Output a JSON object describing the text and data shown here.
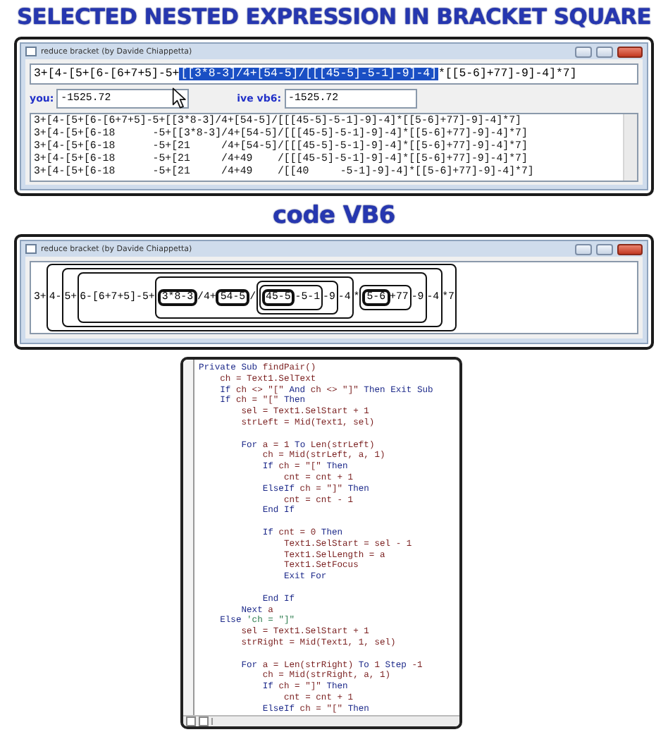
{
  "heading": "SELECTED NESTED EXPRESSION IN BRACKET SQUARE",
  "window": {
    "title": "reduce bracket (by Davide Chiappetta)",
    "expression": {
      "before": "3+[4-[5+[6-[6+7+5]-5+",
      "selected": "[[3*8-3]/4+[54-5]/[[[45-5]-5-1]-9]-4]",
      "after": "*[[5-6]+77]-9]-4]*7]"
    },
    "you_label": "you:",
    "you_value": "-1525.72",
    "native_label": "ive vb6:",
    "native_value": "-1525.72",
    "steps": [
      "3+[4-[5+[6-[6+7+5]-5+[[3*8-3]/4+[54-5]/[[[45-5]-5-1]-9]-4]*[[5-6]+77]-9]-4]*7]",
      "3+[4-[5+[6-18      -5+[[3*8-3]/4+[54-5]/[[[45-5]-5-1]-9]-4]*[[5-6]+77]-9]-4]*7]",
      "3+[4-[5+[6-18      -5+[21     /4+[54-5]/[[[45-5]-5-1]-9]-4]*[[5-6]+77]-9]-4]*7]",
      "3+[4-[5+[6-18      -5+[21     /4+49    /[[[45-5]-5-1]-9]-4]*[[5-6]+77]-9]-4]*7]",
      "3+[4-[5+[6-18      -5+[21     /4+49    /[[40     -5-1]-9]-4]*[[5-6]+77]-9]-4]*7]"
    ]
  },
  "section_title": "code VB6",
  "bracket_window": {
    "title": "reduce bracket (by Davide Chiappetta)",
    "expression": [
      {
        "text": "3+"
      },
      {
        "children": [
          {
            "text": "4-"
          },
          {
            "children": [
              {
                "text": "5+"
              },
              {
                "children": [
                  {
                    "text": "6-[6+7+5]-5+"
                  },
                  {
                    "children": [
                      {
                        "children": [
                          {
                            "text": "3*8-3"
                          }
                        ]
                      },
                      {
                        "text": "/4+"
                      },
                      {
                        "children": [
                          {
                            "text": "54-5"
                          }
                        ]
                      },
                      {
                        "text": "/"
                      },
                      {
                        "children": [
                          {
                            "children": [
                              {
                                "children": [
                                  {
                                    "text": "45-5"
                                  }
                                ]
                              },
                              {
                                "text": "-5-1"
                              }
                            ]
                          },
                          {
                            "text": "-9"
                          }
                        ]
                      },
                      {
                        "text": "-4"
                      }
                    ]
                  },
                  {
                    "text": "*"
                  },
                  {
                    "children": [
                      {
                        "children": [
                          {
                            "text": "5-6"
                          }
                        ]
                      },
                      {
                        "text": "+77"
                      }
                    ]
                  },
                  {
                    "text": "-9"
                  }
                ]
              },
              {
                "text": "-4"
              }
            ]
          },
          {
            "text": "*7"
          }
        ]
      }
    ]
  },
  "code": [
    {
      "kind": "code",
      "spans": [
        {
          "kind": "keyword",
          "text": "Private Sub "
        },
        {
          "kind": "text",
          "text": "findPair()"
        }
      ]
    },
    {
      "kind": "code",
      "spans": [
        {
          "kind": "text",
          "text": "    ch = Text1.SelText"
        }
      ]
    },
    {
      "kind": "code",
      "spans": [
        {
          "kind": "keyword",
          "text": "    If "
        },
        {
          "kind": "text",
          "text": "ch <> \"[\" "
        },
        {
          "kind": "keyword",
          "text": "And "
        },
        {
          "kind": "text",
          "text": "ch <> \"]\" "
        },
        {
          "kind": "keyword",
          "text": "Then Exit Sub"
        }
      ]
    },
    {
      "kind": "code",
      "spans": [
        {
          "kind": "keyword",
          "text": "    If "
        },
        {
          "kind": "text",
          "text": "ch = \"[\" "
        },
        {
          "kind": "keyword",
          "text": "Then"
        }
      ]
    },
    {
      "kind": "code",
      "spans": [
        {
          "kind": "text",
          "text": "        sel = Text1.SelStart + 1"
        }
      ]
    },
    {
      "kind": "code",
      "spans": [
        {
          "kind": "text",
          "text": "        strLeft = Mid(Text1, sel)"
        }
      ]
    },
    {
      "kind": "blank"
    },
    {
      "kind": "code",
      "spans": [
        {
          "kind": "keyword",
          "text": "        For "
        },
        {
          "kind": "text",
          "text": "a = 1 "
        },
        {
          "kind": "keyword",
          "text": "To "
        },
        {
          "kind": "text",
          "text": "Len(strLeft)"
        }
      ]
    },
    {
      "kind": "code",
      "spans": [
        {
          "kind": "text",
          "text": "            ch = Mid(strLeft, a, 1)"
        }
      ]
    },
    {
      "kind": "code",
      "spans": [
        {
          "kind": "keyword",
          "text": "            If "
        },
        {
          "kind": "text",
          "text": "ch = \"[\" "
        },
        {
          "kind": "keyword",
          "text": "Then"
        }
      ]
    },
    {
      "kind": "code",
      "spans": [
        {
          "kind": "text",
          "text": "                cnt = cnt + 1"
        }
      ]
    },
    {
      "kind": "code",
      "spans": [
        {
          "kind": "keyword",
          "text": "            ElseIf "
        },
        {
          "kind": "text",
          "text": "ch = \"]\" "
        },
        {
          "kind": "keyword",
          "text": "Then"
        }
      ]
    },
    {
      "kind": "code",
      "spans": [
        {
          "kind": "text",
          "text": "                cnt = cnt - 1"
        }
      ]
    },
    {
      "kind": "code",
      "spans": [
        {
          "kind": "keyword",
          "text": "            End If"
        }
      ]
    },
    {
      "kind": "blank"
    },
    {
      "kind": "code",
      "spans": [
        {
          "kind": "keyword",
          "text": "            If "
        },
        {
          "kind": "text",
          "text": "cnt = 0 "
        },
        {
          "kind": "keyword",
          "text": "Then"
        }
      ]
    },
    {
      "kind": "code",
      "spans": [
        {
          "kind": "text",
          "text": "                Text1.SelStart = sel - 1"
        }
      ]
    },
    {
      "kind": "code",
      "spans": [
        {
          "kind": "text",
          "text": "                Text1.SelLength = a"
        }
      ]
    },
    {
      "kind": "code",
      "spans": [
        {
          "kind": "text",
          "text": "                Text1.SetFocus"
        }
      ]
    },
    {
      "kind": "code",
      "spans": [
        {
          "kind": "keyword",
          "text": "                Exit For"
        }
      ]
    },
    {
      "kind": "blank"
    },
    {
      "kind": "code",
      "spans": [
        {
          "kind": "keyword",
          "text": "            End If"
        }
      ]
    },
    {
      "kind": "code",
      "spans": [
        {
          "kind": "keyword",
          "text": "        Next "
        },
        {
          "kind": "text",
          "text": "a"
        }
      ]
    },
    {
      "kind": "code",
      "spans": [
        {
          "kind": "keyword",
          "text": "    Else "
        },
        {
          "kind": "comment",
          "text": "'ch = \"]\""
        }
      ]
    },
    {
      "kind": "code",
      "spans": [
        {
          "kind": "text",
          "text": "        sel = Text1.SelStart + 1"
        }
      ]
    },
    {
      "kind": "code",
      "spans": [
        {
          "kind": "text",
          "text": "        strRight = Mid(Text1, 1, sel)"
        }
      ]
    },
    {
      "kind": "blank"
    },
    {
      "kind": "code",
      "spans": [
        {
          "kind": "keyword",
          "text": "        For "
        },
        {
          "kind": "text",
          "text": "a = Len(strRight) "
        },
        {
          "kind": "keyword",
          "text": "To "
        },
        {
          "kind": "text",
          "text": "1 "
        },
        {
          "kind": "keyword",
          "text": "Step "
        },
        {
          "kind": "text",
          "text": "-1"
        }
      ]
    },
    {
      "kind": "code",
      "spans": [
        {
          "kind": "text",
          "text": "            ch = Mid(strRight, a, 1)"
        }
      ]
    },
    {
      "kind": "code",
      "spans": [
        {
          "kind": "keyword",
          "text": "            If "
        },
        {
          "kind": "text",
          "text": "ch = \"]\" "
        },
        {
          "kind": "keyword",
          "text": "Then"
        }
      ]
    },
    {
      "kind": "code",
      "spans": [
        {
          "kind": "text",
          "text": "                cnt = cnt + 1"
        }
      ]
    },
    {
      "kind": "code",
      "spans": [
        {
          "kind": "keyword",
          "text": "            ElseIf "
        },
        {
          "kind": "text",
          "text": "ch = \"[\" "
        },
        {
          "kind": "keyword",
          "text": "Then"
        }
      ]
    }
  ]
}
